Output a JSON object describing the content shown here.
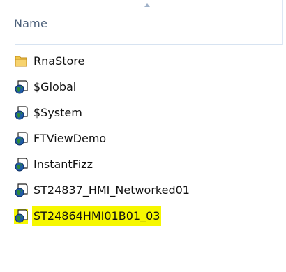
{
  "column_header": {
    "label": "Name",
    "sort": "ascending"
  },
  "items": [
    {
      "name": "RnaStore",
      "icon": "folder-icon",
      "selected": false
    },
    {
      "name": "$Global",
      "icon": "globe-document-icon",
      "selected": false
    },
    {
      "name": "$System",
      "icon": "globe-document-icon",
      "selected": false
    },
    {
      "name": "FTViewDemo",
      "icon": "globe-document-icon",
      "selected": false
    },
    {
      "name": "InstantFizz",
      "icon": "globe-document-icon",
      "selected": false
    },
    {
      "name": "ST24837_HMI_Networked01",
      "icon": "globe-document-icon",
      "selected": false
    },
    {
      "name": "ST24864HMI01B01_03",
      "icon": "globe-document-icon",
      "selected": true
    }
  ],
  "colors": {
    "header_text": "#4c607a",
    "divider": "#d7e3f1",
    "selection_highlight": "#f6f700",
    "folder_yellow": "#f0c64a",
    "globe_blue": "#1f5aa6",
    "globe_green": "#2f8a35"
  }
}
